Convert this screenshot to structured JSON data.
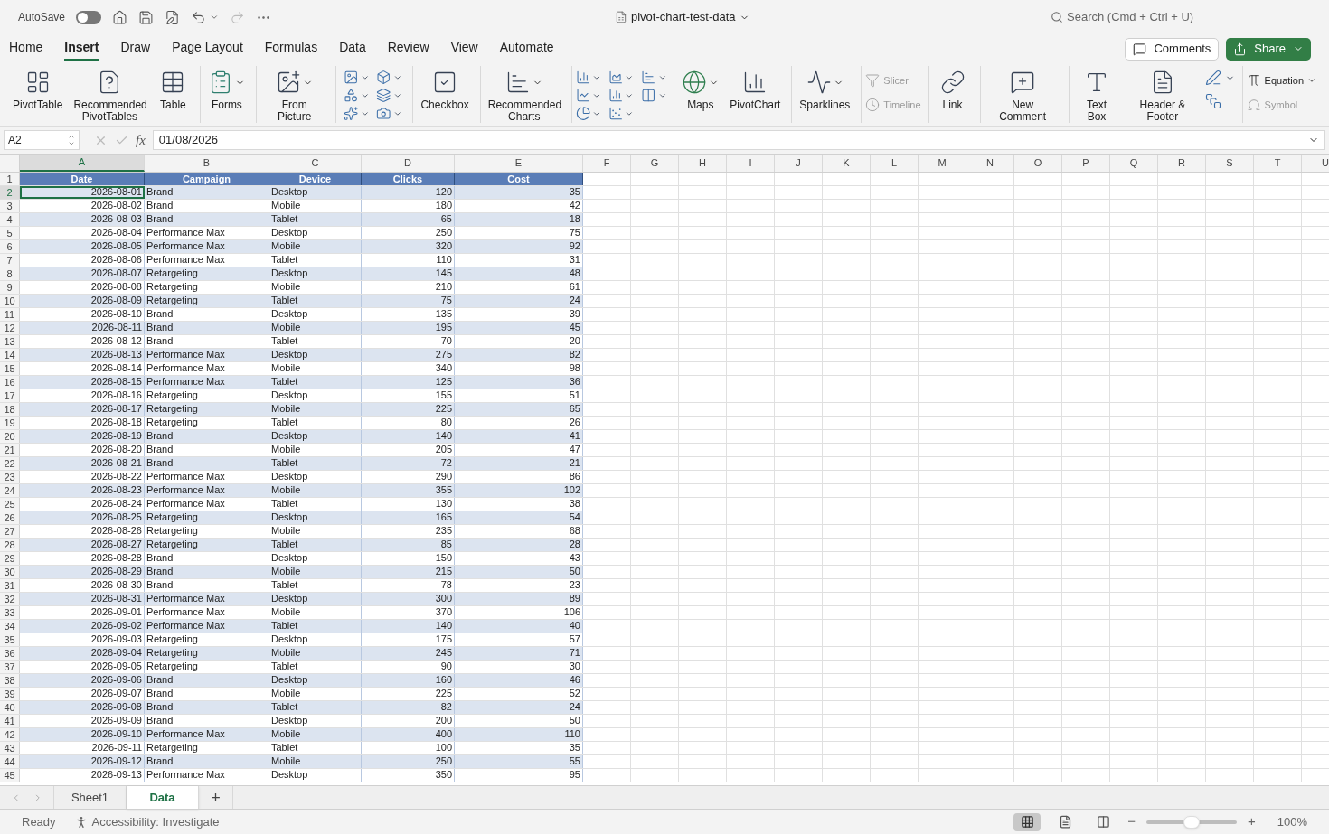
{
  "titlebar": {
    "autosave": {
      "label": "AutoSave",
      "on": false
    },
    "document_title": "pivot-chart-test-data",
    "search": {
      "placeholder": "Search (Cmd + Ctrl + U)"
    }
  },
  "ribbon_tabs": [
    {
      "label": "Home",
      "selected": false
    },
    {
      "label": "Insert",
      "selected": true
    },
    {
      "label": "Draw",
      "selected": false
    },
    {
      "label": "Page Layout",
      "selected": false
    },
    {
      "label": "Formulas",
      "selected": false
    },
    {
      "label": "Data",
      "selected": false
    },
    {
      "label": "Review",
      "selected": false
    },
    {
      "label": "View",
      "selected": false
    },
    {
      "label": "Automate",
      "selected": false
    }
  ],
  "actions": {
    "comments": "Comments",
    "share": "Share"
  },
  "ribbon_groups": [
    {
      "kind": "buttons",
      "items": [
        {
          "kind": "large",
          "label": "PivotTable",
          "dropdown": false
        },
        {
          "kind": "large",
          "label": "Recommended PivotTables",
          "dropdown": false
        },
        {
          "kind": "large",
          "label": "Table",
          "dropdown": false
        }
      ]
    },
    {
      "kind": "buttons",
      "items": [
        {
          "kind": "large",
          "label": "Forms",
          "dropdown": true
        }
      ]
    },
    {
      "kind": "buttons",
      "items": [
        {
          "kind": "large",
          "label": "From Picture",
          "dropdown": true
        }
      ]
    },
    {
      "kind": "illustrations-grid"
    },
    {
      "kind": "buttons",
      "items": [
        {
          "kind": "large",
          "label": "Checkbox",
          "dropdown": false
        }
      ]
    },
    {
      "kind": "buttons",
      "items": [
        {
          "kind": "large",
          "label": "Recommended Charts",
          "dropdown": true
        }
      ]
    },
    {
      "kind": "charts-grid"
    },
    {
      "kind": "buttons",
      "items": [
        {
          "kind": "large",
          "label": "Maps",
          "dropdown": true
        },
        {
          "kind": "large",
          "label": "PivotChart",
          "dropdown": false
        }
      ]
    },
    {
      "kind": "buttons",
      "items": [
        {
          "kind": "large",
          "label": "Sparklines",
          "dropdown": true
        }
      ]
    },
    {
      "kind": "buttons",
      "items": [
        {
          "kind": "small",
          "label": "Slicer",
          "disabled": true
        },
        {
          "kind": "small",
          "label": "Timeline",
          "disabled": true
        }
      ]
    },
    {
      "kind": "buttons",
      "items": [
        {
          "kind": "large",
          "label": "Link",
          "dropdown": false
        }
      ]
    },
    {
      "kind": "buttons",
      "items": [
        {
          "kind": "large",
          "label": "New Comment",
          "dropdown": false
        }
      ]
    },
    {
      "kind": "buttons",
      "items": [
        {
          "kind": "large",
          "label": "Text Box",
          "dropdown": false
        },
        {
          "kind": "large",
          "label": "Header & Footer",
          "dropdown": false
        },
        {
          "kind": "icon-stack"
        }
      ]
    },
    {
      "kind": "buttons",
      "items": [
        {
          "kind": "small",
          "label": "Equation",
          "disabled": false
        },
        {
          "kind": "small",
          "label": "Symbol",
          "disabled": true
        }
      ]
    }
  ],
  "formula_bar": {
    "name_box": "A2",
    "function_label": "fx",
    "value": "01/08/2026"
  },
  "sheet": {
    "columns": [
      {
        "letter": "A",
        "selected": true
      },
      {
        "letter": "B",
        "selected": false
      },
      {
        "letter": "C",
        "selected": false
      },
      {
        "letter": "D",
        "selected": false
      },
      {
        "letter": "E",
        "selected": false
      },
      {
        "letter": "F",
        "selected": false
      },
      {
        "letter": "G",
        "selected": false
      },
      {
        "letter": "H",
        "selected": false
      },
      {
        "letter": "I",
        "selected": false
      },
      {
        "letter": "J",
        "selected": false
      },
      {
        "letter": "K",
        "selected": false
      },
      {
        "letter": "L",
        "selected": false
      },
      {
        "letter": "M",
        "selected": false
      },
      {
        "letter": "N",
        "selected": false
      },
      {
        "letter": "O",
        "selected": false
      },
      {
        "letter": "P",
        "selected": false
      },
      {
        "letter": "Q",
        "selected": false
      },
      {
        "letter": "R",
        "selected": false
      },
      {
        "letter": "S",
        "selected": false
      },
      {
        "letter": "T",
        "selected": false
      },
      {
        "letter": "U",
        "selected": false
      }
    ],
    "header_row": {
      "number": "1",
      "cells": [
        "Date",
        "Campaign",
        "Device",
        "Clicks",
        "Cost"
      ]
    },
    "rows": [
      {
        "number": "2",
        "selected": true,
        "cells": [
          "2026-08-01",
          "Brand",
          "Desktop",
          "120",
          "35"
        ]
      },
      {
        "number": "3",
        "selected": false,
        "cells": [
          "2026-08-02",
          "Brand",
          "Mobile",
          "180",
          "42"
        ]
      },
      {
        "number": "4",
        "selected": false,
        "cells": [
          "2026-08-03",
          "Brand",
          "Tablet",
          "65",
          "18"
        ]
      },
      {
        "number": "5",
        "selected": false,
        "cells": [
          "2026-08-04",
          "Performance Max",
          "Desktop",
          "250",
          "75"
        ]
      },
      {
        "number": "6",
        "selected": false,
        "cells": [
          "2026-08-05",
          "Performance Max",
          "Mobile",
          "320",
          "92"
        ]
      },
      {
        "number": "7",
        "selected": false,
        "cells": [
          "2026-08-06",
          "Performance Max",
          "Tablet",
          "110",
          "31"
        ]
      },
      {
        "number": "8",
        "selected": false,
        "cells": [
          "2026-08-07",
          "Retargeting",
          "Desktop",
          "145",
          "48"
        ]
      },
      {
        "number": "9",
        "selected": false,
        "cells": [
          "2026-08-08",
          "Retargeting",
          "Mobile",
          "210",
          "61"
        ]
      },
      {
        "number": "10",
        "selected": false,
        "cells": [
          "2026-08-09",
          "Retargeting",
          "Tablet",
          "75",
          "24"
        ]
      },
      {
        "number": "11",
        "selected": false,
        "cells": [
          "2026-08-10",
          "Brand",
          "Desktop",
          "135",
          "39"
        ]
      },
      {
        "number": "12",
        "selected": false,
        "cells": [
          "2026-08-11",
          "Brand",
          "Mobile",
          "195",
          "45"
        ]
      },
      {
        "number": "13",
        "selected": false,
        "cells": [
          "2026-08-12",
          "Brand",
          "Tablet",
          "70",
          "20"
        ]
      },
      {
        "number": "14",
        "selected": false,
        "cells": [
          "2026-08-13",
          "Performance Max",
          "Desktop",
          "275",
          "82"
        ]
      },
      {
        "number": "15",
        "selected": false,
        "cells": [
          "2026-08-14",
          "Performance Max",
          "Mobile",
          "340",
          "98"
        ]
      },
      {
        "number": "16",
        "selected": false,
        "cells": [
          "2026-08-15",
          "Performance Max",
          "Tablet",
          "125",
          "36"
        ]
      },
      {
        "number": "17",
        "selected": false,
        "cells": [
          "2026-08-16",
          "Retargeting",
          "Desktop",
          "155",
          "51"
        ]
      },
      {
        "number": "18",
        "selected": false,
        "cells": [
          "2026-08-17",
          "Retargeting",
          "Mobile",
          "225",
          "65"
        ]
      },
      {
        "number": "19",
        "selected": false,
        "cells": [
          "2026-08-18",
          "Retargeting",
          "Tablet",
          "80",
          "26"
        ]
      },
      {
        "number": "20",
        "selected": false,
        "cells": [
          "2026-08-19",
          "Brand",
          "Desktop",
          "140",
          "41"
        ]
      },
      {
        "number": "21",
        "selected": false,
        "cells": [
          "2026-08-20",
          "Brand",
          "Mobile",
          "205",
          "47"
        ]
      },
      {
        "number": "22",
        "selected": false,
        "cells": [
          "2026-08-21",
          "Brand",
          "Tablet",
          "72",
          "21"
        ]
      },
      {
        "number": "23",
        "selected": false,
        "cells": [
          "2026-08-22",
          "Performance Max",
          "Desktop",
          "290",
          "86"
        ]
      },
      {
        "number": "24",
        "selected": false,
        "cells": [
          "2026-08-23",
          "Performance Max",
          "Mobile",
          "355",
          "102"
        ]
      },
      {
        "number": "25",
        "selected": false,
        "cells": [
          "2026-08-24",
          "Performance Max",
          "Tablet",
          "130",
          "38"
        ]
      },
      {
        "number": "26",
        "selected": false,
        "cells": [
          "2026-08-25",
          "Retargeting",
          "Desktop",
          "165",
          "54"
        ]
      },
      {
        "number": "27",
        "selected": false,
        "cells": [
          "2026-08-26",
          "Retargeting",
          "Mobile",
          "235",
          "68"
        ]
      },
      {
        "number": "28",
        "selected": false,
        "cells": [
          "2026-08-27",
          "Retargeting",
          "Tablet",
          "85",
          "28"
        ]
      },
      {
        "number": "29",
        "selected": false,
        "cells": [
          "2026-08-28",
          "Brand",
          "Desktop",
          "150",
          "43"
        ]
      },
      {
        "number": "30",
        "selected": false,
        "cells": [
          "2026-08-29",
          "Brand",
          "Mobile",
          "215",
          "50"
        ]
      },
      {
        "number": "31",
        "selected": false,
        "cells": [
          "2026-08-30",
          "Brand",
          "Tablet",
          "78",
          "23"
        ]
      },
      {
        "number": "32",
        "selected": false,
        "cells": [
          "2026-08-31",
          "Performance Max",
          "Desktop",
          "300",
          "89"
        ]
      },
      {
        "number": "33",
        "selected": false,
        "cells": [
          "2026-09-01",
          "Performance Max",
          "Mobile",
          "370",
          "106"
        ]
      },
      {
        "number": "34",
        "selected": false,
        "cells": [
          "2026-09-02",
          "Performance Max",
          "Tablet",
          "140",
          "40"
        ]
      },
      {
        "number": "35",
        "selected": false,
        "cells": [
          "2026-09-03",
          "Retargeting",
          "Desktop",
          "175",
          "57"
        ]
      },
      {
        "number": "36",
        "selected": false,
        "cells": [
          "2026-09-04",
          "Retargeting",
          "Mobile",
          "245",
          "71"
        ]
      },
      {
        "number": "37",
        "selected": false,
        "cells": [
          "2026-09-05",
          "Retargeting",
          "Tablet",
          "90",
          "30"
        ]
      },
      {
        "number": "38",
        "selected": false,
        "cells": [
          "2026-09-06",
          "Brand",
          "Desktop",
          "160",
          "46"
        ]
      },
      {
        "number": "39",
        "selected": false,
        "cells": [
          "2026-09-07",
          "Brand",
          "Mobile",
          "225",
          "52"
        ]
      },
      {
        "number": "40",
        "selected": false,
        "cells": [
          "2026-09-08",
          "Brand",
          "Tablet",
          "82",
          "24"
        ]
      },
      {
        "number": "41",
        "selected": false,
        "cells": [
          "2026-09-09",
          "Brand",
          "Desktop",
          "200",
          "50"
        ]
      },
      {
        "number": "42",
        "selected": false,
        "cells": [
          "2026-09-10",
          "Performance Max",
          "Mobile",
          "400",
          "110"
        ]
      },
      {
        "number": "43",
        "selected": false,
        "cells": [
          "2026-09-11",
          "Retargeting",
          "Tablet",
          "100",
          "35"
        ]
      },
      {
        "number": "44",
        "selected": false,
        "cells": [
          "2026-09-12",
          "Brand",
          "Mobile",
          "250",
          "55"
        ]
      },
      {
        "number": "45",
        "selected": false,
        "cells": [
          "2026-09-13",
          "Performance Max",
          "Desktop",
          "350",
          "95"
        ]
      }
    ]
  },
  "sheet_tabs": [
    {
      "label": "Sheet1",
      "selected": false
    },
    {
      "label": "Data",
      "selected": true
    }
  ],
  "add_sheet": "+",
  "status_bar": {
    "status": "Ready",
    "accessibility": "Accessibility: Investigate",
    "views": [
      {
        "kind": "normal",
        "selected": true
      },
      {
        "kind": "page-layout",
        "selected": false
      },
      {
        "kind": "page-break",
        "selected": false
      }
    ],
    "zoom": {
      "level": 0.5,
      "minus": "−",
      "plus": "+",
      "reading": "100%"
    }
  }
}
